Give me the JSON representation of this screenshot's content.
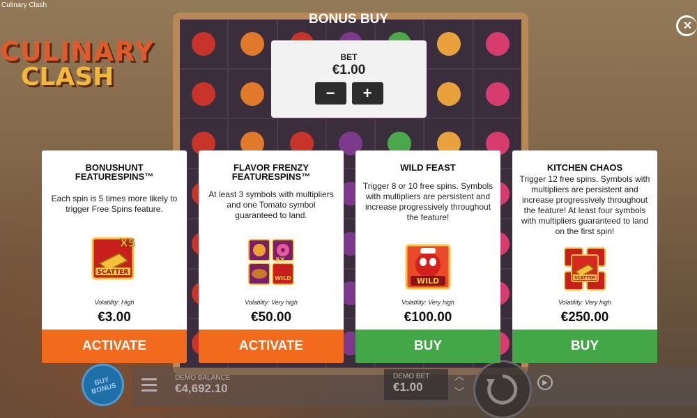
{
  "app": {
    "title": "Culinary Clash"
  },
  "logo": {
    "line1": "CULINARY",
    "line2": "CLASH"
  },
  "dialog": {
    "title": "BONUS BUY",
    "bet": {
      "label": "BET",
      "value": "€1.00",
      "minus": "−",
      "plus": "+"
    }
  },
  "cards": [
    {
      "title": "BONUSHUNT FEATURESPINS™",
      "description": "Each spin is 5 times more likely to trigger Free Spins feature.",
      "art_icon": "scatter-x5-icon",
      "art_label": "SCATTER",
      "art_badge": "X5",
      "volatility": "Volatility: High",
      "price": "€3.00",
      "action": "ACTIVATE",
      "action_color": "#f26a1b"
    },
    {
      "title": "FLAVOR FRENZY FEATURESPINS™",
      "description": "At least 3 symbols with multipliers and one Tomato symbol guaranteed to land.",
      "art_icon": "multiplier-symbols-icon",
      "art_label": "WILD",
      "art_badge": "5X",
      "volatility": "Volatility: Very high",
      "price": "€50.00",
      "action": "ACTIVATE",
      "action_color": "#f26a1b"
    },
    {
      "title": "WILD FEAST",
      "description": "Trigger 8 or 10 free spins. Symbols with multipliers are persistent and increase progressively throughout the feature!",
      "art_icon": "tomato-wild-icon",
      "art_label": "WILD",
      "art_badge": "",
      "volatility": "Volatility: Very high",
      "price": "€100.00",
      "action": "BUY",
      "action_color": "#43a748"
    },
    {
      "title": "KITCHEN CHAOS",
      "description": "Trigger 12 free spins. Symbols with multipliers are persistent and increase progressively throughout the feature! At least four symbols with multipliers guaranteed to land on the first spin!",
      "art_icon": "scatter-stack-icon",
      "art_label": "SCATTER",
      "art_badge": "",
      "volatility": "Volatility: Very high",
      "price": "€250.00",
      "action": "BUY",
      "action_color": "#43a748"
    }
  ],
  "bottom_bar": {
    "buy_bonus_label": "BUY BONUS",
    "balance_label": "DEMO BALANCE",
    "balance_value": "€4,692.10",
    "bet_label": "DEMO BET",
    "bet_value": "€1.00"
  },
  "colors": {
    "activate": "#f26a1b",
    "buy": "#43a748",
    "panel": "#f2f2f2"
  }
}
